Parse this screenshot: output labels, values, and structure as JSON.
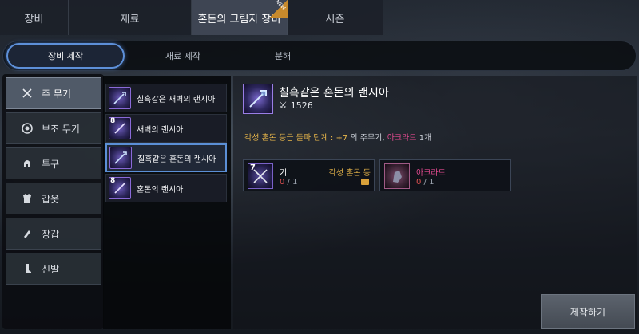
{
  "top_tabs": [
    {
      "label": "장비"
    },
    {
      "label": "재료"
    },
    {
      "label": "혼돈의 그림자 장비",
      "active": true,
      "badge": "NEW"
    },
    {
      "label": "시즌"
    }
  ],
  "sub_tabs": [
    {
      "label": "장비 제작",
      "active": true
    },
    {
      "label": "재료 제작"
    },
    {
      "label": "분해"
    }
  ],
  "categories": [
    {
      "label": "주 무기",
      "icon": "crossed-swords-icon",
      "active": true
    },
    {
      "label": "보조 무기",
      "icon": "shield-ring-icon"
    },
    {
      "label": "투구",
      "icon": "helmet-icon"
    },
    {
      "label": "갑옷",
      "icon": "armor-icon"
    },
    {
      "label": "장갑",
      "icon": "gloves-icon"
    },
    {
      "label": "신발",
      "icon": "boots-icon"
    }
  ],
  "items": [
    {
      "label": "칠흑같은 새벽의 랜시아",
      "level": ""
    },
    {
      "label": "새벽의 랜시아",
      "level": "8"
    },
    {
      "label": "칠흑같은 혼돈의 랜시아",
      "level": "",
      "active": true
    },
    {
      "label": "혼돈의 랜시아",
      "level": "8"
    }
  ],
  "detail": {
    "title": "칠흑같은 혼돈의 랜시아",
    "power": "1526",
    "requirement": {
      "prefix": "각성 혼돈 등급 돌파 단계 : +7",
      "mid": " 의 주무기, ",
      "material": "아크라드",
      "suffix": " 1개"
    }
  },
  "materials": [
    {
      "name": "기",
      "sub": "각성 혼돈 등",
      "have": "0",
      "need": "1",
      "level": "7"
    },
    {
      "name": "아크라드",
      "have": "0",
      "need": "1"
    }
  ],
  "craft_button": "제작하기",
  "colors": {
    "accent": "#5d8fd8",
    "gold": "#e8b64a",
    "pink": "#e24a8f",
    "deficit": "#e05050"
  }
}
